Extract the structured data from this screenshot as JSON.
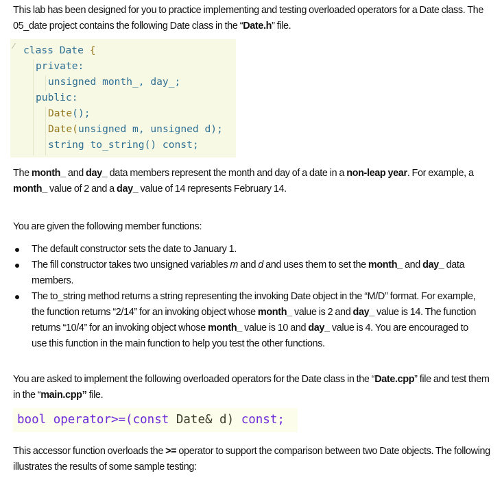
{
  "intro": {
    "part1": "This lab has been designed for you to practice implementing and testing overloaded operators for a Date class. The 05_date project contains the following Date class in the “",
    "file": "Date.h",
    "part2": "” file."
  },
  "class_code": {
    "line1": {
      "kw": "class",
      "name": "Date",
      "brace": "{"
    },
    "line2": "private:",
    "line3": "unsigned month_, day_;",
    "line4": "public:",
    "line5": {
      "fn": "Date",
      "rest": "();"
    },
    "line6": {
      "fn": "Date",
      "paren": "(",
      "args": "unsigned m, unsigned d",
      "close": ");"
    },
    "line7": "string to_string() const;"
  },
  "members_desc": {
    "t1": "The ",
    "b1": "month_",
    "t2": " and ",
    "b2": "day_",
    "t3": " data members represent the month and day of a date in a ",
    "b3": "non-leap year",
    "t4": ". For example, a ",
    "b4": "month_",
    "t5": " value of 2 and a ",
    "b5": "day_",
    "t6": " value of 14 represents February 14."
  },
  "given_heading": "You are given the following member functions:",
  "bullets": {
    "item1": "The default constructor sets the date to January 1.",
    "item2": {
      "t1": "The fill constructor takes two unsigned variables ",
      "i1": "m",
      "t2": " and ",
      "i2": "d",
      "t3": " and uses them to set the ",
      "b1": "month_",
      "t4": " and ",
      "b2": "day_",
      "t5": " data members."
    },
    "item3": {
      "t1": "The to_string method returns a string representing the invoking Date object in the “M/D” format. For example, the function returns “2/14” for an invoking object whose ",
      "b1": "month_",
      "t2": " value is 2 and ",
      "b2": "day_",
      "t3": " value is 14. The function returns “10/4” for an invoking object whose ",
      "b3": "month_",
      "t4": " value is 10 and ",
      "b4": "day_",
      "t5": " value is 4. You are encouraged to use this function in the main function to help you test the other functions."
    }
  },
  "implement": {
    "t1": "You are asked to implement the following overloaded operators for the Date class in the “",
    "b1": "Date.cpp",
    "t2": "” file and test them in the “",
    "b2": "main.cpp”",
    "t3": " file."
  },
  "operator_code": {
    "bool": "bool",
    "op": "operator>=(",
    "const1": "const",
    "type": "Date& d)",
    "const2": "const;"
  },
  "accessor_desc": {
    "t1": "This accessor function overloads the ",
    "b1": ">=",
    "t2": " operator to support the comparison between two Date objects. The following illustrates the results of some sample testing:"
  }
}
